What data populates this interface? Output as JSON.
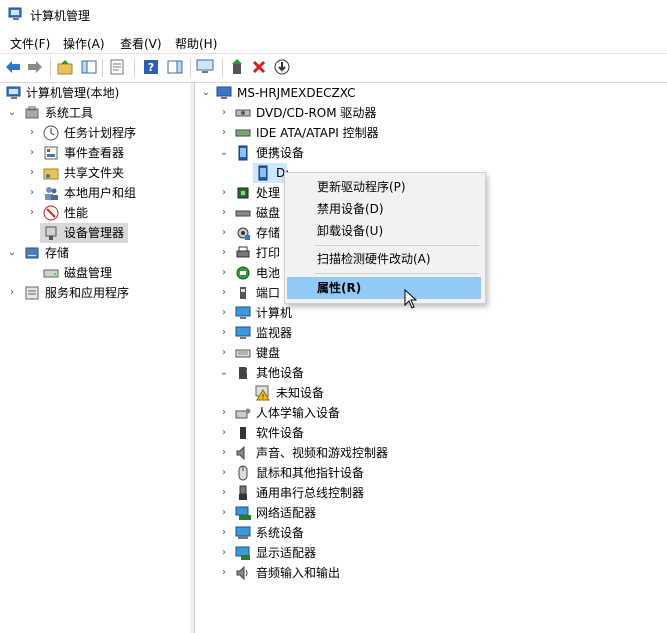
{
  "window": {
    "title": "计算机管理"
  },
  "menu": [
    "文件(F)",
    "操作(A)",
    "查看(V)",
    "帮助(H)"
  ],
  "toolbar": [
    "back-icon",
    "forward-icon",
    "up-folder-icon",
    "show-hide-tree-icon",
    "properties-icon",
    "help-icon",
    "view-icon",
    "monitor-icon",
    "update-driver-icon",
    "uninstall-icon",
    "disable-icon"
  ],
  "tree": {
    "root": "计算机管理(本地)",
    "system_tools": "系统工具",
    "task_scheduler": "任务计划程序",
    "event_viewer": "事件查看器",
    "shared_folders": "共享文件夹",
    "local_users": "本地用户和组",
    "performance": "性能",
    "device_manager": "设备管理器",
    "storage": "存储",
    "disk_management": "磁盘管理",
    "services_apps": "服务和应用程序"
  },
  "devices": {
    "computer": "MS-HRJMEXDECZXC",
    "dvd": "DVD/CD-ROM 驱动器",
    "ide": "IDE ATA/ATAPI 控制器",
    "portable": "便携设备",
    "portable_child": "D:",
    "processor": "处理",
    "disk": "磁盘",
    "storage_ctrl": "存储",
    "print": "打印",
    "battery": "电池",
    "ports": "端口",
    "computer_cat": "计算机",
    "monitors": "监视器",
    "keyboard": "键盘",
    "other": "其他设备",
    "unknown": "未知设备",
    "hid": "人体学输入设备",
    "software": "软件设备",
    "sound": "声音、视频和游戏控制器",
    "mouse": "鼠标和其他指针设备",
    "usb": "通用串行总线控制器",
    "network": "网络适配器",
    "system": "系统设备",
    "display": "显示适配器",
    "audio_io": "音频输入和输出"
  },
  "context_menu": {
    "update": "更新驱动程序(P)",
    "disable": "禁用设备(D)",
    "uninstall": "卸载设备(U)",
    "scan": "扫描检测硬件改动(A)",
    "properties": "属性(R)"
  }
}
